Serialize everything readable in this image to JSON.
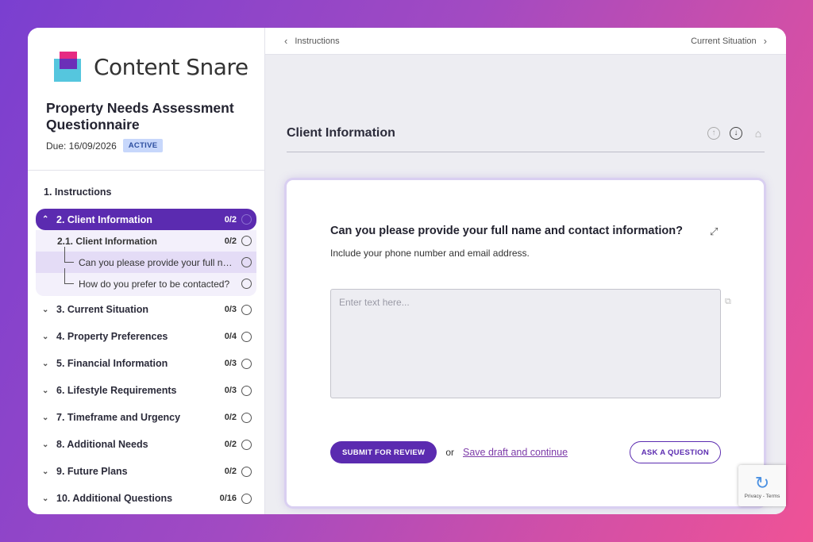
{
  "brand": {
    "name": "Content Snare"
  },
  "questionnaire": {
    "title": "Property Needs Assessment Questionnaire",
    "due": "Due: 16/09/2026",
    "status": "ACTIVE"
  },
  "nav": {
    "instructions": "1. Instructions",
    "active": {
      "label": "2. Client Information",
      "count": "0/2"
    },
    "sub": {
      "label": "2.1. Client Information",
      "count": "0/2"
    },
    "questions": [
      "Can you please provide your full name and contact information?",
      "How do you prefer to be contacted?"
    ],
    "sections": [
      {
        "label": "3. Current Situation",
        "count": "0/3"
      },
      {
        "label": "4. Property Preferences",
        "count": "0/4"
      },
      {
        "label": "5. Financial Information",
        "count": "0/3"
      },
      {
        "label": "6. Lifestyle Requirements",
        "count": "0/3"
      },
      {
        "label": "7. Timeframe and Urgency",
        "count": "0/2"
      },
      {
        "label": "8. Additional Needs",
        "count": "0/2"
      },
      {
        "label": "9. Future Plans",
        "count": "0/2"
      },
      {
        "label": "10. Additional Questions",
        "count": "0/16"
      }
    ]
  },
  "topbar": {
    "prev": "Instructions",
    "next": "Current Situation"
  },
  "section": {
    "title": "Client Information"
  },
  "question": {
    "text": "Can you please provide your full name and contact information?",
    "hint": "Include your phone number and email address.",
    "placeholder": "Enter text here..."
  },
  "actions": {
    "submit": "SUBMIT FOR REVIEW",
    "or": "or",
    "save": "Save draft and continue",
    "ask": "ASK A QUESTION"
  },
  "recaptcha": {
    "text": "Privacy - Terms"
  },
  "colors": {
    "accent": "#5b2bb0",
    "link": "#7c3aa8",
    "badge": "#c7d7fb"
  },
  "icons": [
    "arrow-up-circle-icon",
    "arrow-down-circle-icon",
    "home-icon",
    "expand-icon",
    "copy-icon",
    "chevron-left-icon",
    "chevron-right-icon",
    "chevron-down-icon",
    "chevron-up-icon"
  ]
}
